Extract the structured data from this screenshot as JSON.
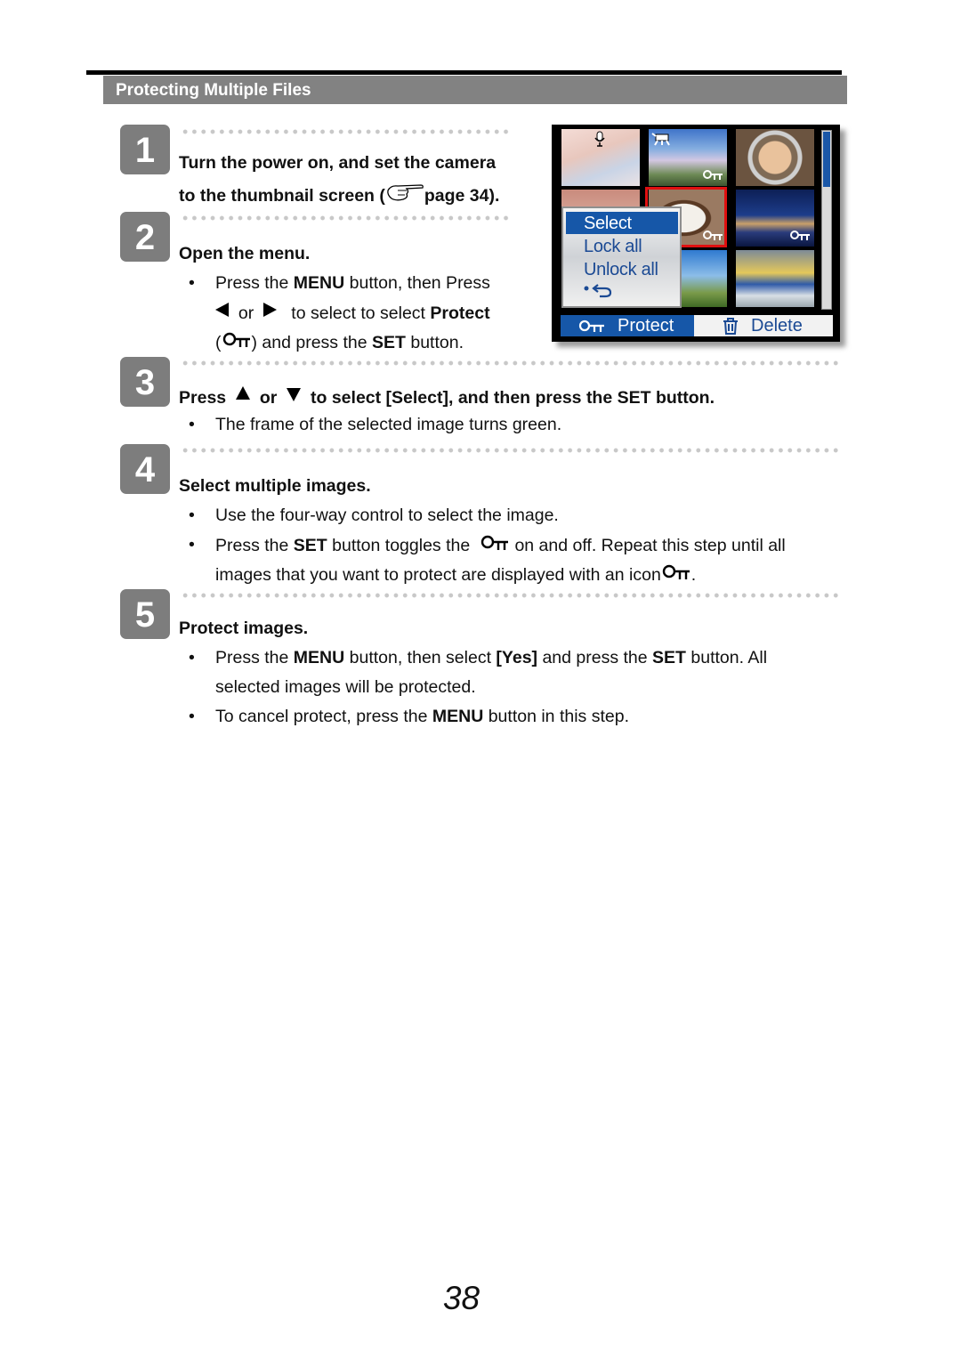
{
  "section": {
    "title": "Protecting Multiple Files"
  },
  "steps": [
    {
      "number": "1",
      "heading_line1": "Turn the power on, and set the camera",
      "heading_line2_pre": "to the thumbnail screen (",
      "heading_line2_ref": "page 34).",
      "ref_icon": "pointing-hand-icon"
    },
    {
      "number": "2",
      "heading": "Open the menu.",
      "bullets": [
        {
          "line1_pre": "Press the ",
          "line1_bold": "MENU",
          "line1_post": " button, then Press",
          "line2_or": "or",
          "line2_post": "to select to select ",
          "line2_bold": "Protect",
          "line3_open": "(",
          "line3_post": ") and press the ",
          "line3_bold": "SET",
          "line3_end": " button."
        }
      ]
    },
    {
      "number": "3",
      "heading_pre": "Press",
      "heading_or": "or",
      "heading_post": "to select [Select], and then press the SET button.",
      "bullets": [
        "The frame of the selected image turns green."
      ]
    },
    {
      "number": "4",
      "heading": "Select multiple images.",
      "bullets": [
        {
          "text": "Use the four-way control to select the image."
        },
        {
          "pre": "Press the ",
          "bold": "SET",
          "mid": " button toggles the ",
          "post": " on and off. Repeat this step until all",
          "line2": "images that you want to protect are displayed with an icon",
          "line2_end": "."
        }
      ]
    },
    {
      "number": "5",
      "heading": "Protect images.",
      "bullets": [
        {
          "pre": "Press the ",
          "b1": "MENU",
          "mid1": " button, then select ",
          "b2": "[Yes]",
          "mid2": " and press the ",
          "b3": "SET",
          "post": " button. All",
          "line2": "selected images will be protected."
        },
        {
          "pre": "To cancel protect, press the ",
          "b1": "MENU",
          "post": " button in this step."
        }
      ]
    }
  ],
  "bullet_char": "•",
  "camera_screen": {
    "popup_menu": [
      "Select",
      "Lock all",
      "Unlock all",
      "•⮌"
    ],
    "popup_selected_index": 0,
    "bottom_tabs": [
      {
        "label": "Protect",
        "icon": "key-icon",
        "active": true
      },
      {
        "label": "Delete",
        "icon": "trash-icon",
        "active": false
      }
    ],
    "scroll_position": 0.3,
    "colors": {
      "highlight": "#1657a8",
      "selected_frame": "#e01010",
      "text": "#1b4a94"
    }
  },
  "page_number": "38"
}
